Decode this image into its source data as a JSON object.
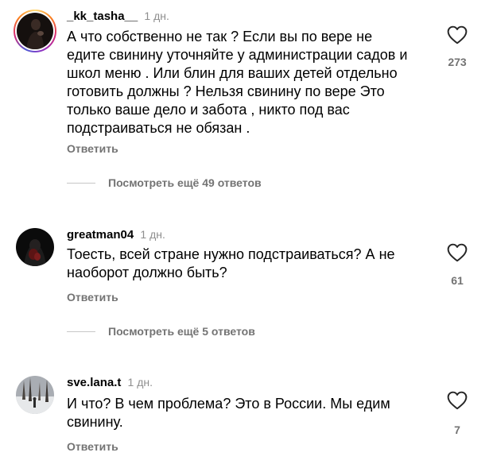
{
  "comments": [
    {
      "username": "_kk_tasha__",
      "time": "1 дн.",
      "text": "А что собственно не так ? Если вы по вере не едите свинину уточняйте у администрации садов и школ меню . Или блин для ваших детей отдельно готовить должны ? Нельзя свинину по вере Это только ваше дело и забота , никто под вас подстраиваться не обязан .",
      "likes": "273",
      "reply_label": "Ответить",
      "view_replies": "Посмотреть ещё 49 ответов"
    },
    {
      "username": "greatman04",
      "time": "1 дн.",
      "text": "Тоесть, всей стране нужно подстраиваться? А не наоборот должно быть?",
      "likes": "61",
      "reply_label": "Ответить",
      "view_replies": "Посмотреть ещё 5 ответов"
    },
    {
      "username": "sve.lana.t",
      "time": "1 дн.",
      "text": "И что? В чем проблема? Это в России. Мы едим свинину.",
      "likes": "7",
      "reply_label": "Ответить"
    }
  ],
  "icons": {
    "like": "heart-outline-icon"
  },
  "colors": {
    "secondary_text": "#737373",
    "story_ring": "#d62976"
  }
}
